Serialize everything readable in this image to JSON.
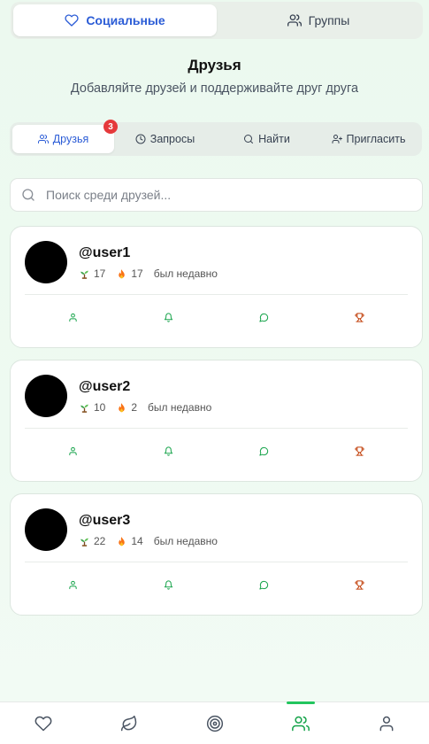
{
  "top_tabs": [
    {
      "label": "Социальные",
      "active": true,
      "icon": "heart-icon"
    },
    {
      "label": "Группы",
      "active": false,
      "icon": "users-icon"
    }
  ],
  "header": {
    "title": "Друзья",
    "subtitle": "Добавляйте друзей и поддерживайте друг друга"
  },
  "sub_tabs": [
    {
      "label": "Друзья",
      "active": true,
      "badge": "3",
      "icon": "users-icon"
    },
    {
      "label": "Запросы",
      "active": false,
      "icon": "clock-icon"
    },
    {
      "label": "Найти",
      "active": false,
      "icon": "search-icon"
    },
    {
      "label": "Пригласить",
      "active": false,
      "icon": "user-plus-icon"
    }
  ],
  "search": {
    "placeholder": "Поиск среди друзей...",
    "value": ""
  },
  "friends": [
    {
      "username": "@user1",
      "plants": "17",
      "streak": "17",
      "status": "был недавно"
    },
    {
      "username": "@user2",
      "plants": "10",
      "streak": "2",
      "status": "был недавно"
    },
    {
      "username": "@user3",
      "plants": "22",
      "streak": "14",
      "status": "был недавно"
    }
  ],
  "card_actions": [
    "profile-icon",
    "bell-icon",
    "message-icon",
    "trophy-icon"
  ],
  "bottom_nav": [
    {
      "icon": "heart-icon",
      "active": false
    },
    {
      "icon": "leaf-icon",
      "active": false
    },
    {
      "icon": "target-icon",
      "active": false
    },
    {
      "icon": "users-icon",
      "active": true
    },
    {
      "icon": "user-icon",
      "active": false
    }
  ],
  "colors": {
    "accent_blue": "#2b5cd6",
    "accent_green": "#22c55e",
    "action_green": "#16a34a",
    "action_orange": "#c2410c",
    "badge_red": "#e5393b"
  }
}
